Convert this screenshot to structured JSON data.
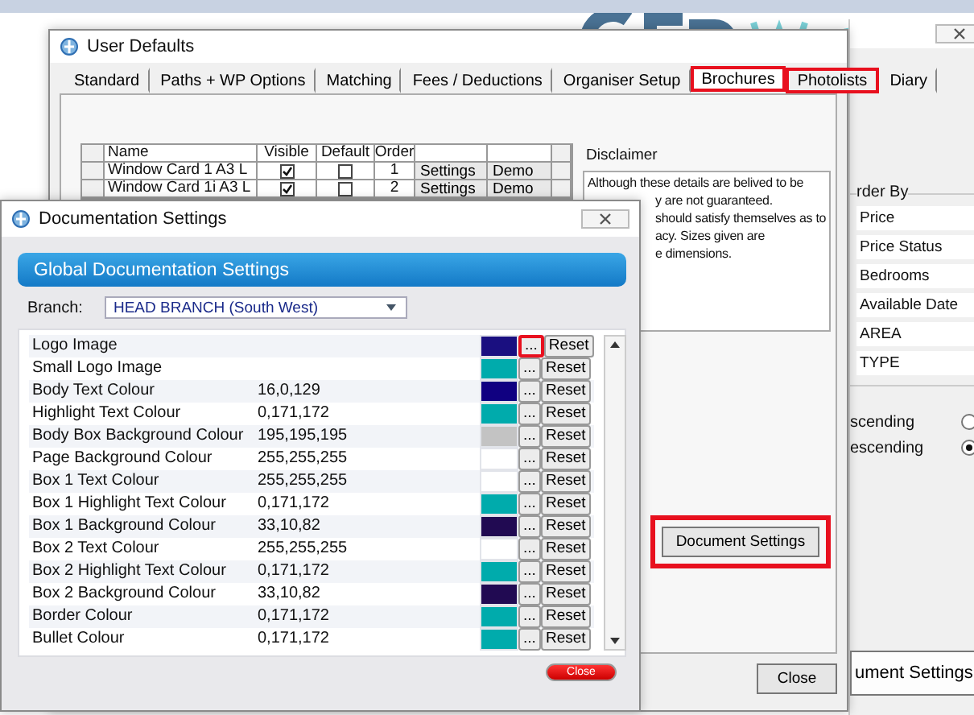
{
  "user_defaults": {
    "title": "User Defaults",
    "tabs": [
      {
        "label": "Standard",
        "selected": false,
        "highlighted": false
      },
      {
        "label": "Paths + WP Options",
        "selected": false,
        "highlighted": false
      },
      {
        "label": "Matching",
        "selected": false,
        "highlighted": false
      },
      {
        "label": "Fees / Deductions",
        "selected": false,
        "highlighted": false
      },
      {
        "label": "Organiser Setup",
        "selected": false,
        "highlighted": false
      },
      {
        "label": "Brochures",
        "selected": true,
        "highlighted": true
      },
      {
        "label": "Photolists",
        "selected": false,
        "highlighted": true
      },
      {
        "label": "Diary",
        "selected": false,
        "highlighted": false
      }
    ],
    "grid": {
      "columns": [
        "Name",
        "Visible",
        "Default",
        "Order"
      ],
      "rows": [
        {
          "name": "Window Card 1 A3 L",
          "visible": true,
          "default": false,
          "order": "1",
          "settings": "Settings",
          "demo": "Demo"
        },
        {
          "name": "Window Card 1i A3 L",
          "visible": true,
          "default": false,
          "order": "2",
          "settings": "Settings",
          "demo": "Demo"
        }
      ]
    },
    "disclaimer": {
      "label": "Disclaimer",
      "lines": [
        "Although these details are belived to be",
        "y are not guaranteed.",
        "should satisfy themselves as to",
        "acy. Sizes given are",
        "e dimensions."
      ]
    },
    "document_settings_button": {
      "label": "Document Settings",
      "highlighted": true
    },
    "close_button": "Close"
  },
  "back_window": {
    "order_by_label": "rder By",
    "order_by": [
      "Price",
      "Price Status",
      "Bedrooms",
      "Available Date",
      "AREA",
      "TYPE"
    ],
    "direction": [
      {
        "label": "scending",
        "selected": false
      },
      {
        "label": "escending",
        "selected": true
      }
    ],
    "button": "ument Settings"
  },
  "documentation_settings": {
    "title": "Documentation Settings",
    "header": "Global Documentation Settings",
    "branch_label": "Branch:",
    "branch": "HEAD BRANCH (South West)",
    "rows": [
      {
        "name": "Logo Image",
        "color": "#1a0f80",
        "more": "...",
        "reset": "Reset",
        "highlighted": true
      },
      {
        "name": "Small Logo Image",
        "color": "#00abac",
        "more": "...",
        "reset": "Reset",
        "highlighted": false
      },
      {
        "name": "Body Text Colour",
        "value": "16,0,129",
        "color": "#100081",
        "more": "...",
        "reset": "Reset",
        "highlighted": false
      },
      {
        "name": "Highlight Text Colour",
        "value": "0,171,172",
        "color": "#00abac",
        "more": "...",
        "reset": "Reset",
        "highlighted": false
      },
      {
        "name": "Body Box Background Colour",
        "value": "195,195,195",
        "color": "#c3c3c3",
        "more": "...",
        "reset": "Reset",
        "highlighted": false
      },
      {
        "name": "Page Background Colour",
        "value": "255,255,255",
        "color": "#ffffff",
        "more": "...",
        "reset": "Reset",
        "highlighted": false
      },
      {
        "name": "Box 1 Text Colour",
        "value": "255,255,255",
        "color": "#ffffff",
        "more": "...",
        "reset": "Reset",
        "highlighted": false
      },
      {
        "name": "Box 1 Highlight Text Colour",
        "value": "0,171,172",
        "color": "#00abac",
        "more": "...",
        "reset": "Reset",
        "highlighted": false
      },
      {
        "name": "Box 1 Background Colour",
        "value": "33,10,82",
        "color": "#210a52",
        "more": "...",
        "reset": "Reset",
        "highlighted": false
      },
      {
        "name": "Box 2 Text Colour",
        "value": "255,255,255",
        "color": "#ffffff",
        "more": "...",
        "reset": "Reset",
        "highlighted": false
      },
      {
        "name": "Box 2 Highlight Text Colour",
        "value": "0,171,172",
        "color": "#00abac",
        "more": "...",
        "reset": "Reset",
        "highlighted": false
      },
      {
        "name": "Box 2 Background Colour",
        "value": "33,10,82",
        "color": "#210a52",
        "more": "...",
        "reset": "Reset",
        "highlighted": false
      },
      {
        "name": "Border Colour",
        "value": "0,171,172",
        "color": "#00abac",
        "more": "...",
        "reset": "Reset",
        "highlighted": false
      },
      {
        "name": "Bullet Colour",
        "value": "0,171,172",
        "color": "#00abac",
        "more": "...",
        "reset": "Reset",
        "highlighted": false
      }
    ],
    "close_button": "Close"
  }
}
